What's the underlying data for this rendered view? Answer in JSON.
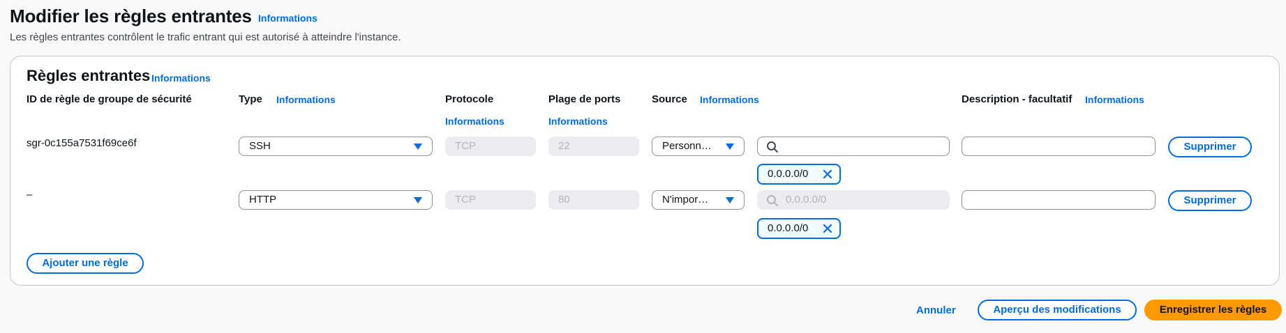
{
  "page": {
    "title": "Modifier les règles entrantes",
    "title_info": "Informations",
    "description": "Les règles entrantes contrôlent le trafic entrant qui est autorisé à atteindre l'instance."
  },
  "section": {
    "title": "Règles entrantes",
    "title_info": "Informations"
  },
  "columns": {
    "rule_id": "ID de règle de groupe de sécurité",
    "type": "Type",
    "type_info": "Informations",
    "protocol": "Protocole",
    "protocol_info": "Informations",
    "port_range": "Plage de ports",
    "port_range_info": "Informations",
    "source": "Source",
    "source_info": "Informations",
    "description": "Description - facultatif",
    "description_info": "Informations"
  },
  "rules": [
    {
      "id": "sgr-0c155a7531f69ce6f",
      "type": "SSH",
      "protocol": "TCP",
      "port_range": "22",
      "source": "Personn…",
      "search_value": "",
      "search_placeholder": "",
      "token": "0.0.0.0/0",
      "description": "",
      "delete_label": "Supprimer"
    },
    {
      "id": "–",
      "type": "HTTP",
      "protocol": "TCP",
      "port_range": "80",
      "source": "N'impor…",
      "search_value": "",
      "search_placeholder": "0.0.0.0/0",
      "token": "0.0.0.0/0",
      "description": "",
      "delete_label": "Supprimer"
    }
  ],
  "add_rule_label": "Ajouter une règle",
  "footer": {
    "cancel_label": "Annuler",
    "preview_label": "Aperçu des modifications",
    "save_label": "Enregistrer les règles"
  },
  "colors": {
    "accent": "#006ce0",
    "primary_button": "#ff9900",
    "disabled_field": "#ebebf0"
  }
}
